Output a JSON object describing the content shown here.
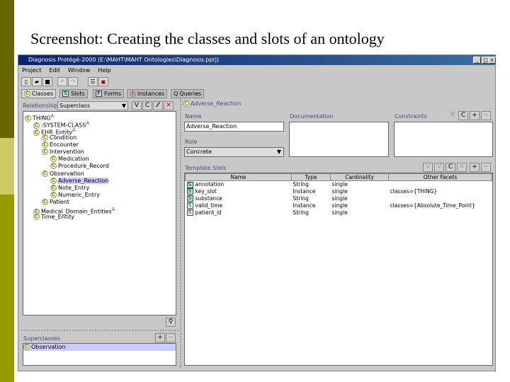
{
  "slide_title": "Screenshot: Creating the classes and slots of an ontology",
  "window": {
    "title": "Diagnosis Protégé-2000   (E:\\MAHT\\MAHT Ontologies\\Diagnosis.pprj)",
    "min": "_",
    "max": "□",
    "close": "×"
  },
  "menu": [
    "Project",
    "Edit",
    "Window",
    "Help"
  ],
  "tabs": [
    {
      "icon": "C",
      "label": "Classes"
    },
    {
      "icon": "S",
      "label": "Slots"
    },
    {
      "icon": "F",
      "label": "Forms"
    },
    {
      "icon": "I",
      "label": "Instances"
    },
    {
      "icon": "Q",
      "label": "Queries"
    }
  ],
  "class_browser": {
    "relationship_label": "Relationship",
    "relationship_value": "Superclass",
    "tree": [
      {
        "label": "THING",
        "indent": 0,
        "mark": "A"
      },
      {
        "label": ":SYSTEM-CLASS",
        "indent": 1,
        "mark": "A"
      },
      {
        "label": "EHR_Entity",
        "indent": 1,
        "mark": "A"
      },
      {
        "label": "Condition",
        "indent": 2
      },
      {
        "label": "Encounter",
        "indent": 2
      },
      {
        "label": "Intervention",
        "indent": 2
      },
      {
        "label": "Medication",
        "indent": 3
      },
      {
        "label": "Procedure_Record",
        "indent": 3
      },
      {
        "label": "Observation",
        "indent": 2
      },
      {
        "label": "Adverse_Reaction",
        "indent": 3,
        "selected": true
      },
      {
        "label": "Note_Entry",
        "indent": 3
      },
      {
        "label": "Numeric_Entry",
        "indent": 3
      },
      {
        "label": "Patient",
        "indent": 2
      },
      {
        "label": "Medical_Domain_Entities",
        "indent": 1,
        "mark": "A"
      },
      {
        "label": "Time_Entity",
        "indent": 1
      }
    ],
    "superclasses_label": "Superclasses",
    "superclasses": [
      "Observation"
    ]
  },
  "class_form": {
    "header": "Adverse_Reaction",
    "name_label": "Name",
    "name_value": "Adverse_Reaction",
    "doc_label": "Documentation",
    "constraints_label": "Constraints",
    "role_label": "Role",
    "role_value": "Concrete",
    "template_slots_label": "Template Slots",
    "columns": [
      "Name",
      "Type",
      "Cardinality",
      "Other Facets"
    ],
    "slots": [
      {
        "name": "annotation",
        "type": "String",
        "cardinality": "single",
        "facets": ""
      },
      {
        "name": "key_slot",
        "type": "Instance",
        "cardinality": "single",
        "facets": "classes={THING}"
      },
      {
        "name": "substance",
        "type": "String",
        "cardinality": "single",
        "facets": ""
      },
      {
        "name": "valid_time",
        "type": "Instance",
        "cardinality": "single",
        "facets": "classes={Absolute_Time_Point}"
      },
      {
        "name": "patient_id",
        "type": "String",
        "cardinality": "single",
        "facets": ""
      }
    ]
  }
}
